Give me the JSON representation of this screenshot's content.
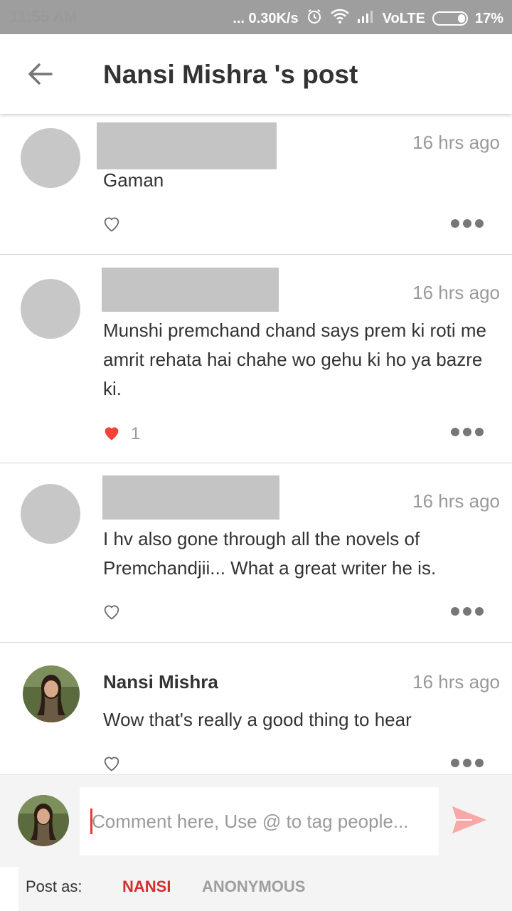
{
  "status_bar": {
    "time": "11:55 AM",
    "net_speed": "... 0.30K/s",
    "network": "VoLTE",
    "battery": "17%",
    "icons": [
      "alarm-icon",
      "wifi-icon",
      "signal-icon",
      "battery-icon"
    ]
  },
  "header": {
    "back_icon": "arrow-left-icon",
    "title": "Nansi Mishra 's post"
  },
  "comments": [
    {
      "author": "",
      "author_hidden": true,
      "time": "16 hrs ago",
      "text": "Gaman",
      "liked": false,
      "likes": ""
    },
    {
      "author": "",
      "author_hidden": true,
      "time": "16 hrs ago",
      "text": "Munshi premchand chand says  prem ki roti me amrit rehata  hai chahe wo gehu  ki ho ya bazre ki.",
      "liked": true,
      "likes": "1"
    },
    {
      "author": "",
      "author_hidden": true,
      "time": "16 hrs ago",
      "text": "I hv also gone through all the novels of Premchandjii... What a great writer he is.",
      "liked": false,
      "likes": ""
    },
    {
      "author": "Nansi Mishra",
      "author_hidden": false,
      "time": "16 hrs ago",
      "text": "Wow that's really a good thing to hear",
      "liked": false,
      "likes": ""
    }
  ],
  "composer": {
    "placeholder": "Comment here, Use @ to tag people...",
    "send_icon": "send-icon"
  },
  "post_as": {
    "label": "Post as:",
    "options": [
      "NANSI",
      "ANONYMOUS"
    ],
    "selected": "NANSI"
  },
  "colors": {
    "accent": "#d32f2f",
    "like_red": "#f44336",
    "send_pink": "#f8a8a8",
    "placeholder_gray": "#c4c4c4"
  }
}
